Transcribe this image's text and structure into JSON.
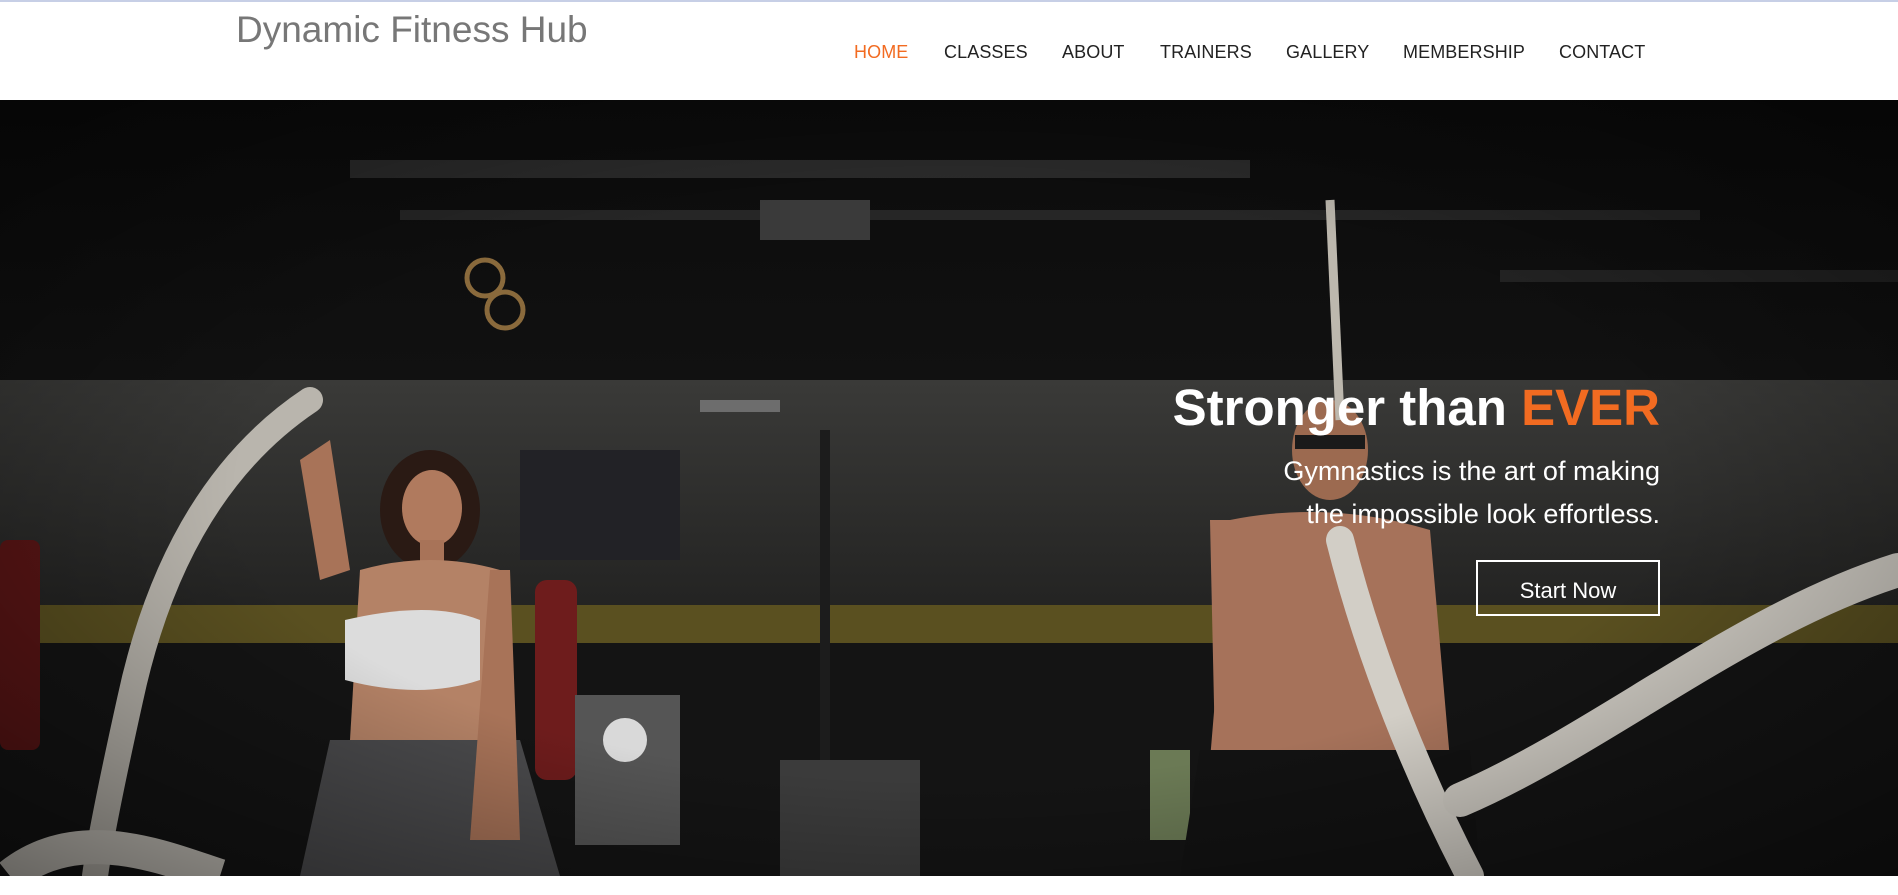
{
  "brand": {
    "name": "Dynamic Fitness Hub"
  },
  "nav": {
    "items": [
      "HOME",
      "CLASSES",
      "ABOUT",
      "TRAINERS",
      "GALLERY",
      "MEMBERSHIP",
      "CONTACT"
    ],
    "active": "HOME"
  },
  "hero": {
    "headline_main": "Stronger than",
    "headline_accent": "EVER",
    "subtitle_line1": "Gymnastics is the art of making",
    "subtitle_line2": "the impossible look effortless.",
    "cta_label": "Start Now",
    "background_image": "gym-battle-ropes-photo"
  },
  "colors": {
    "accent": "#f26b21",
    "brand_text": "#777777",
    "nav_text": "#222222",
    "hero_text": "#ffffff"
  }
}
